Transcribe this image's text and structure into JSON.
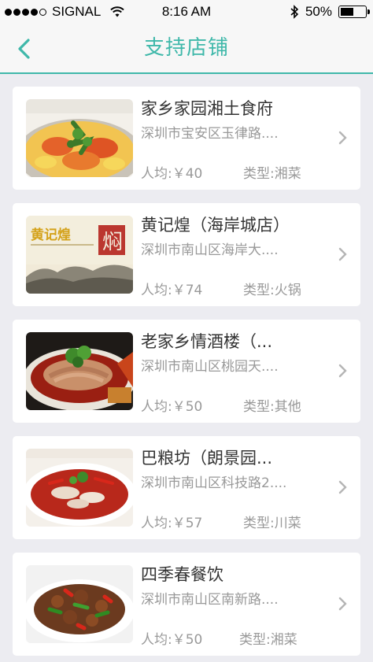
{
  "status_bar": {
    "carrier": "SIGNAL",
    "time": "8:16 AM",
    "battery": "50%"
  },
  "nav": {
    "title": "支持店铺",
    "accent_color": "#3fb8aa"
  },
  "stores": [
    {
      "name": "家乡家园湘土食府",
      "address": "深圳市宝安区玉律路....",
      "price": "人均:￥40",
      "type": "类型:湘菜",
      "image": "fried-shrimp-dish"
    },
    {
      "name": "黄记煌（海岸城店）",
      "address": "深圳市南山区海岸大....",
      "price": "人均:￥74",
      "type": "类型:火锅",
      "image": "huangjihuang-logo",
      "logo_text": "黄记煌",
      "logo_seal": "焖"
    },
    {
      "name": "老家乡情酒楼（...",
      "address": "深圳市南山区桃园天....",
      "price": "人均:￥50",
      "type": "类型:其他",
      "image": "sliced-meat-chili-dish"
    },
    {
      "name": "巴粮坊（朗景园...",
      "address": "深圳市南山区科技路2....",
      "price": "人均:￥57",
      "type": "类型:川菜",
      "image": "fish-chili-soup"
    },
    {
      "name": "四季春餐饮",
      "address": "深圳市南山区南新路....",
      "price": "人均:￥50",
      "type": "类型:湘菜",
      "image": "stir-fried-beef-peppers"
    }
  ]
}
